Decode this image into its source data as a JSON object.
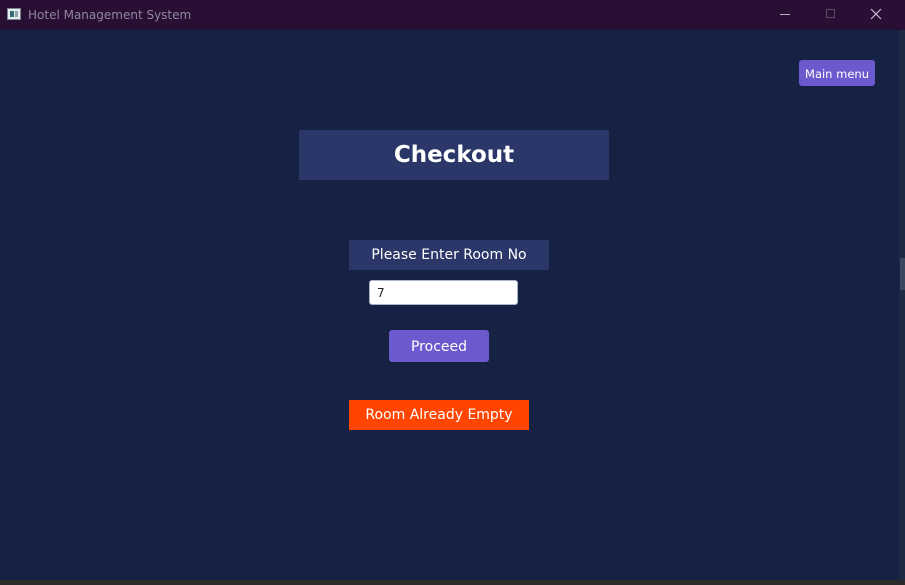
{
  "window": {
    "title": "Hotel Management System",
    "icon": "app-window-icon",
    "controls": {
      "minimize_icon": "minimize-icon",
      "maximize_icon": "maximize-icon",
      "close_icon": "close-icon"
    }
  },
  "header": {
    "main_menu_label": "Main menu"
  },
  "page": {
    "title": "Checkout",
    "room_label": "Please Enter Room No",
    "room_input_value": "7",
    "proceed_label": "Proceed",
    "status_message": "Room Already Empty"
  },
  "colors": {
    "background": "#152244",
    "titlebar": "#2a0f35",
    "panel": "#2b3768",
    "accent_button": "#6a5acd",
    "status_error": "#ff4500"
  }
}
